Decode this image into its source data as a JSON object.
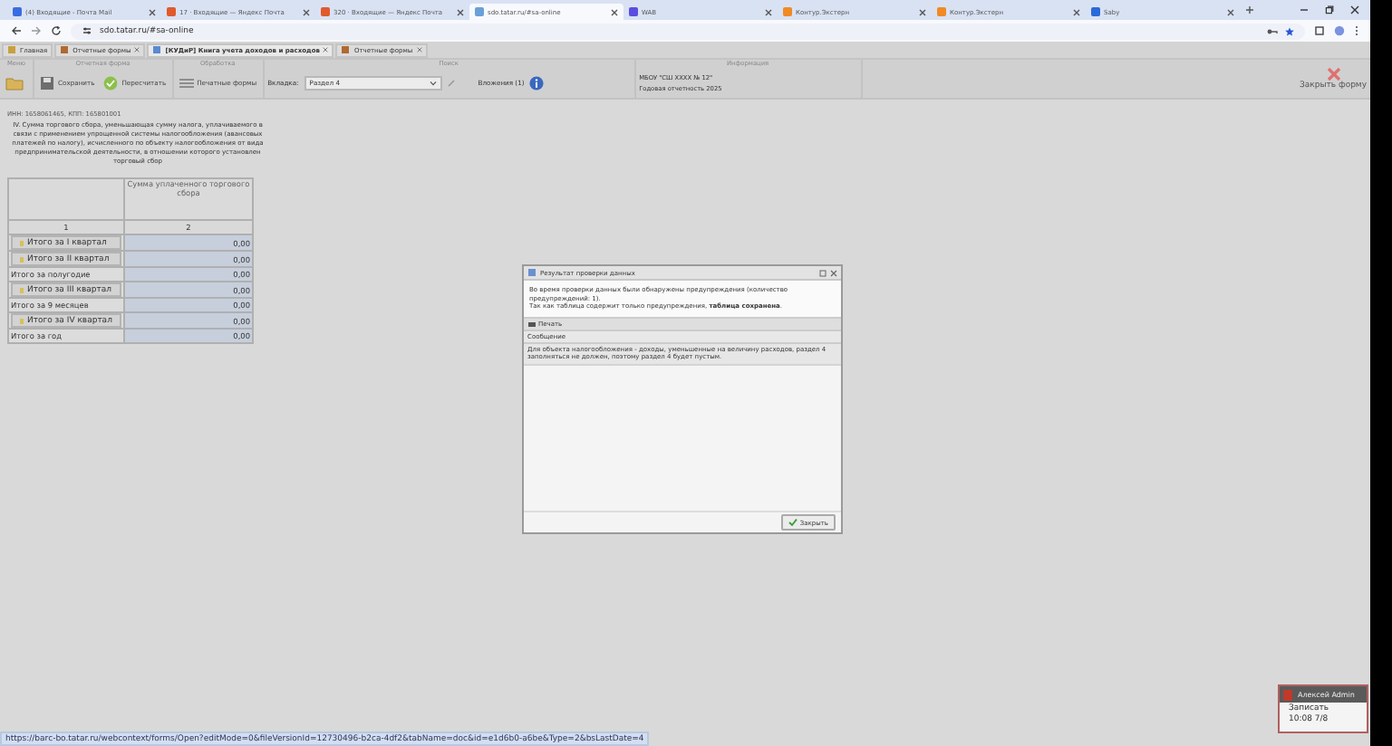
{
  "browser_tabs": [
    {
      "title": "(4) Входящие - Почта Mail",
      "selected": false
    },
    {
      "title": "17 · Входящие — Яндекс Почта",
      "selected": false
    },
    {
      "title": "320 · Входящие — Яндекс Почта",
      "selected": false
    },
    {
      "title": "sdo.tatar.ru/#sa-online",
      "selected": true
    },
    {
      "title": "WAB",
      "selected": false
    },
    {
      "title": "Контур.Экстерн",
      "selected": false
    },
    {
      "title": "Контур.Экстерн",
      "selected": false
    },
    {
      "title": "Saby",
      "selected": false
    }
  ],
  "address": "sdo.tatar.ru/#sa-online",
  "app_tabs": [
    {
      "label": "Главная",
      "selected": false
    },
    {
      "label": "Отчетные формы",
      "selected": false
    },
    {
      "label": "[КУДиР] Книга учета доходов и расходов",
      "selected": true
    },
    {
      "label": "Отчетные формы",
      "selected": false
    }
  ],
  "toolbar": {
    "groups": [
      "Меню",
      "Отчетная форма",
      "Обработка",
      "Поиск",
      "Информация"
    ],
    "save": "Сохранить",
    "recalc": "Пересчитать",
    "print_forms": "Печатные формы",
    "tab_label": "Вкладка:",
    "tab_value": "Раздел 4",
    "attachments": "Вложения (1)",
    "info": [
      "МБОУ \"СШ ХХХХ № 12\"",
      "Годовая отчетность 2025"
    ],
    "close": "Закрыть форму"
  },
  "form": {
    "ids": "ИНН: 1658061465, КПП: 165801001",
    "heading": "IV. Сумма торгового сбора, уменьшающая сумму налога, уплачиваемого в связи с применением упрощенной системы налогообложения (авансовых платежей по налогу), исчисленного по объекту налогообложения от вида предпринимательской деятельности, в отношении которого установлен торговый сбор",
    "column_header": "Сумма уплаченного торгового сбора",
    "column_numbers": [
      "1",
      "2"
    ],
    "rows": [
      {
        "label": "Итого за I квартал",
        "kind": "button",
        "value": "0,00"
      },
      {
        "label": "Итого за II квартал",
        "kind": "button",
        "value": "0,00"
      },
      {
        "label": "Итого за полугодие",
        "kind": "plain",
        "value": "0,00"
      },
      {
        "label": "Итого за III квартал",
        "kind": "button",
        "value": "0,00"
      },
      {
        "label": "Итого за 9 месяцев",
        "kind": "plain",
        "value": "0,00"
      },
      {
        "label": "Итого за IV квартал",
        "kind": "button",
        "value": "0,00"
      },
      {
        "label": "Итого за год",
        "kind": "plain",
        "value": "0,00"
      }
    ]
  },
  "dialog": {
    "title": "Результат проверки данных",
    "message": "Во время проверки данных были обнаружены предупреждения (количество предупреждений: 1).",
    "message2": "Так как таблица содержит только предупреждения, **таблица сохранена**.",
    "print": "Печать",
    "column": "Сообщение",
    "rows": [
      "Для объекта налогообложения - доходы, уменьшенные на величину расходов, раздел 4 заполняться не должен, поэтому раздел 4 будет пустым."
    ],
    "close": "Закрыть"
  },
  "notification": {
    "title": "Алексей Admin",
    "lines": [
      "Записать",
      "10:08 7/8"
    ]
  },
  "status_url": "https://barс-bo.tatar.ru/webcontext/forms/Open?editMode=0&fileVersionId=12730496-b2ca-4df2&tabName=doc&id=e1d6b0-a6be&Type=2&bsLastDate=4"
}
